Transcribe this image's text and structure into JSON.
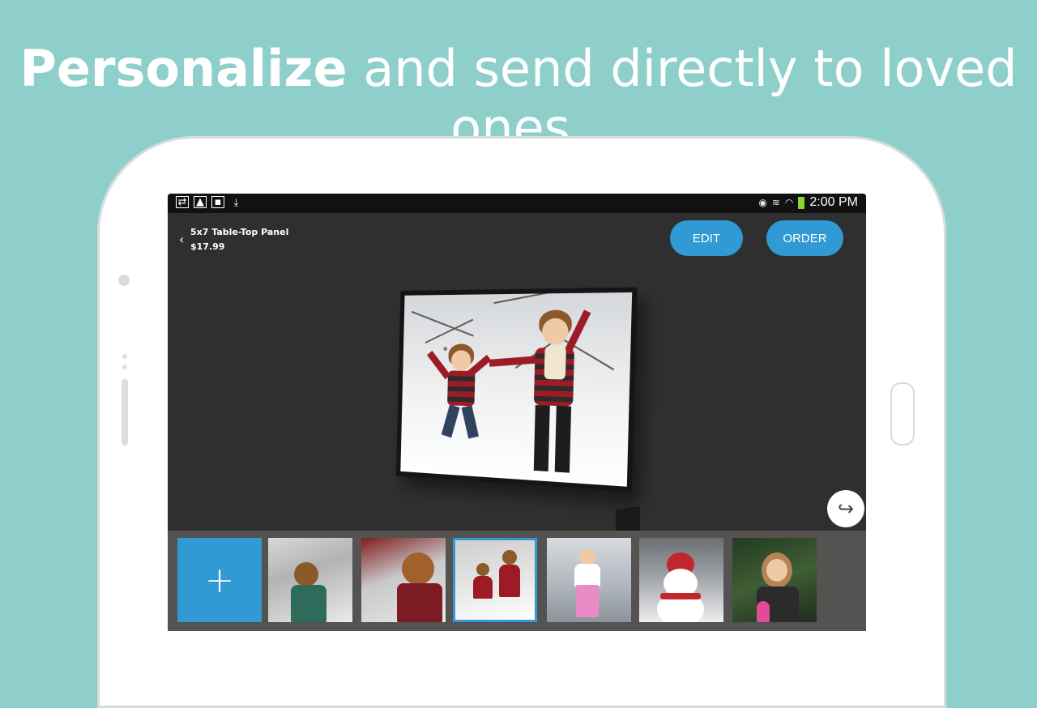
{
  "headline": {
    "bold": "Personalize",
    "rest": " and send directly to loved ones."
  },
  "statusbar": {
    "time": "2:00 PM",
    "left_icons": [
      "sync-icon",
      "image-icon",
      "flipboard-icon",
      "download-icon"
    ],
    "right_icons": [
      "eye-icon",
      "vibrate-icon",
      "wifi-icon",
      "battery-icon"
    ]
  },
  "product": {
    "name": "5x7 Table-Top Panel",
    "price": "$17.99"
  },
  "actions": {
    "edit_label": "EDIT",
    "order_label": "ORDER"
  },
  "strip": {
    "add_symbol": "+",
    "thumbnails": [
      {
        "name": "kid-in-snow"
      },
      {
        "name": "boy-blowing-snow"
      },
      {
        "name": "kids-jumping",
        "selected": true
      },
      {
        "name": "girl-in-pink-snow"
      },
      {
        "name": "snowman"
      },
      {
        "name": "girl-in-woods"
      }
    ]
  },
  "colors": {
    "background": "#8ecfcb",
    "accent": "#3199d4",
    "screen": "#2f2f2f",
    "strip": "#555252"
  }
}
